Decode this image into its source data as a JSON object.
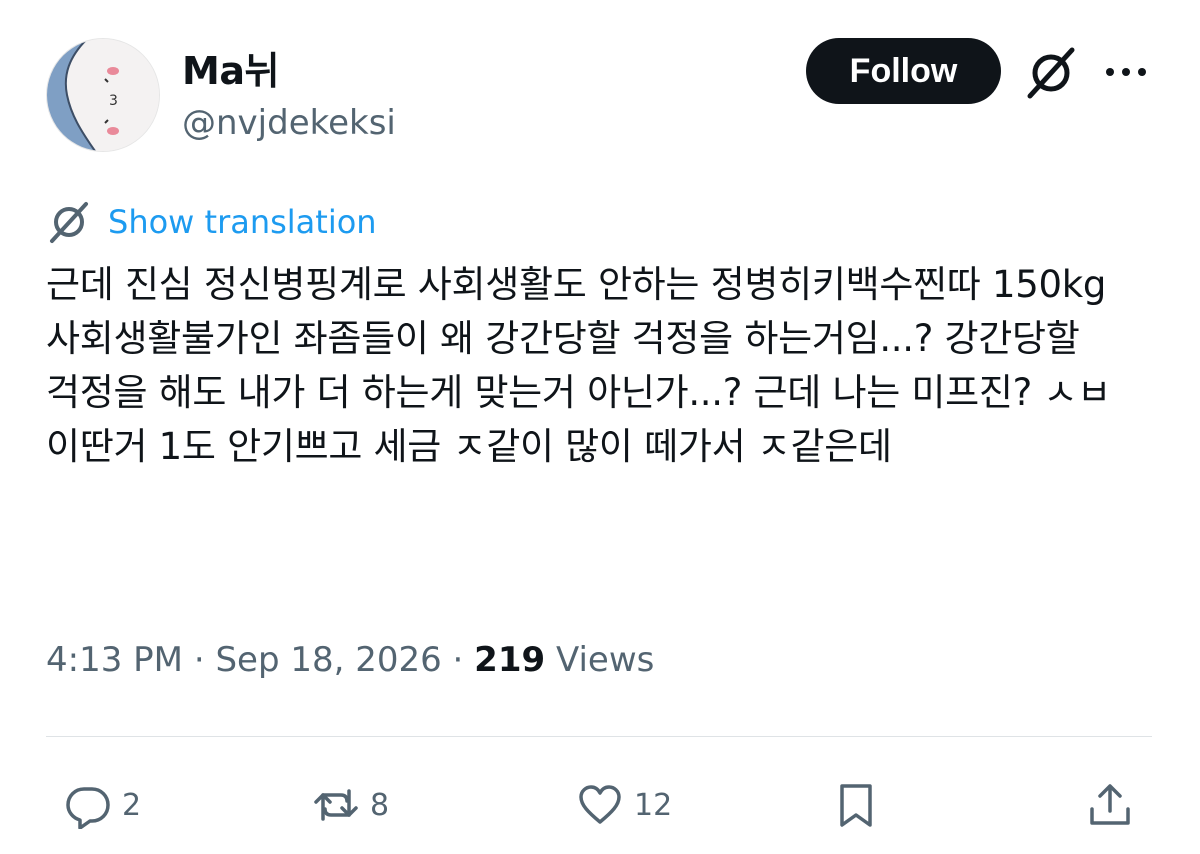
{
  "author": {
    "display_name": "Ma뉘",
    "handle": "@nvjdekeksi"
  },
  "header": {
    "follow_label": "Follow"
  },
  "translation": {
    "label": "Show translation"
  },
  "tweet": {
    "text": "근데 진심 정신병핑계로 사회생활도 안하는 정병히키백수찐따 150kg 사회생활불가인 좌좀들이 왜 강간당할 걱정을 하는거임...? 강간당할 걱정을 해도 내가 더 하는게 맞는거 아닌가...? 근데 나는 미프진? ㅅㅂ 이딴거 1도 안기쁘고 세금 ㅈ같이 많이 떼가서 ㅈ같은데",
    "time": "4:13 PM",
    "separator": "·",
    "date": "Sep 18, 2026",
    "views_count": "219",
    "views_label": "Views"
  },
  "actions": {
    "reply_count": "2",
    "retweet_count": "8",
    "like_count": "12"
  },
  "colors": {
    "accent": "#1d9bf0",
    "text_primary": "#0f1419",
    "text_secondary": "#536471",
    "button_bg": "#0f1419"
  }
}
